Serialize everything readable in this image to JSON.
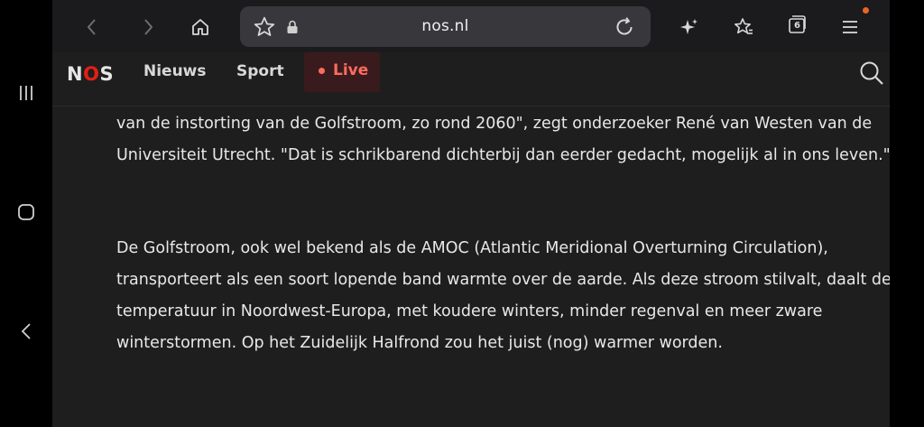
{
  "browser": {
    "url": "nos.nl",
    "open_tabs": "6",
    "accent_color": "#e8642a"
  },
  "icons": {
    "back": "chevron-left-icon",
    "forward": "chevron-right-icon",
    "home": "home-icon",
    "bookmark": "star-icon",
    "lock": "lock-icon",
    "reload": "reload-icon",
    "ai": "sparkle-icon",
    "favorites": "star-list-icon",
    "tabs": "tabs-icon",
    "menu": "hamburger-icon",
    "search": "search-icon"
  },
  "site": {
    "logo_left": "N",
    "logo_mid": "O",
    "logo_right": "S",
    "brand_color": "#e61e14",
    "nav": {
      "nieuws": "Nieuws",
      "sport": "Sport",
      "live": "Live"
    },
    "live_color": "#ff6b5e"
  },
  "article": {
    "paragraph_1": "van de instorting van de Golfstroom, zo rond 2060\", zegt onderzoeker René van Westen van de Universiteit Utrecht. \"Dat is schrikbarend dichterbij dan eerder gedacht, mogelijk al in ons leven.\"",
    "paragraph_2": "De Golfstroom, ook wel bekend als de AMOC (Atlantic Meridional Overturning Circulation), transporteert als een soort lopende band warmte over de aarde. Als deze stroom stilvalt, daalt de temperatuur in Noordwest-Europa, met koudere winters, minder regenval en meer zware winterstormen. Op het Zuidelijk Halfrond zou het juist (nog) warmer worden."
  }
}
